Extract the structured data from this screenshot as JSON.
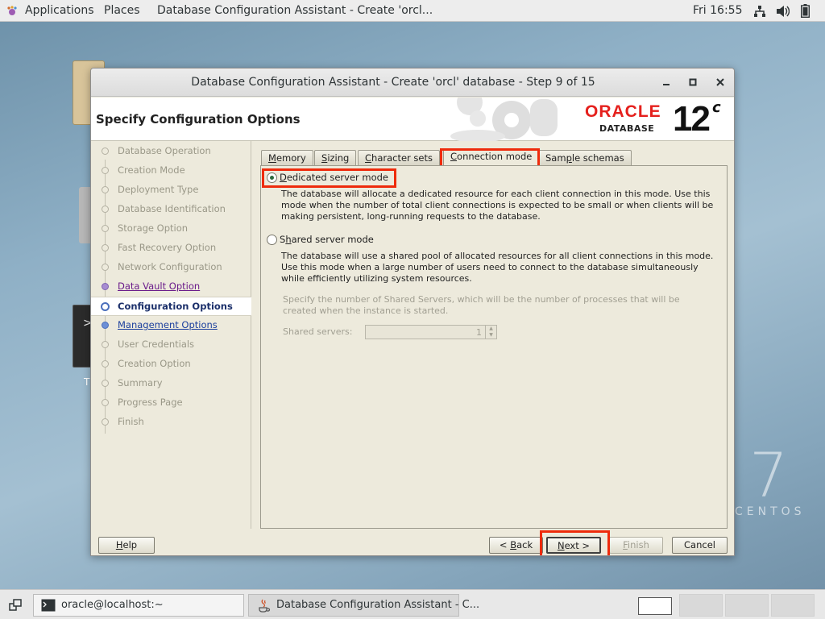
{
  "topbar": {
    "applications": "Applications",
    "places": "Places",
    "window_title": "Database Configuration Assistant - Create 'orcl...",
    "clock": "Fri 16:55"
  },
  "desktop": {
    "terminal_label": "T",
    "centos_seven": "7",
    "centos_word": "CENTOS"
  },
  "window": {
    "title": "Database Configuration Assistant - Create 'orcl' database - Step 9 of 15",
    "page_title": "Specify Configuration Options",
    "oracle": {
      "brand": "ORACLE",
      "product": "DATABASE",
      "version": "12",
      "version_suffix": "c"
    }
  },
  "steps": [
    {
      "label": "Database Operation",
      "state": "done"
    },
    {
      "label": "Creation Mode",
      "state": "done"
    },
    {
      "label": "Deployment Type",
      "state": "done"
    },
    {
      "label": "Database Identification",
      "state": "done"
    },
    {
      "label": "Storage Option",
      "state": "done"
    },
    {
      "label": "Fast Recovery Option",
      "state": "done"
    },
    {
      "label": "Network Configuration",
      "state": "done"
    },
    {
      "label": "Data Vault Option",
      "state": "visited"
    },
    {
      "label": "Configuration Options",
      "state": "current"
    },
    {
      "label": "Management Options",
      "state": "link"
    },
    {
      "label": "User Credentials",
      "state": "todo"
    },
    {
      "label": "Creation Option",
      "state": "todo"
    },
    {
      "label": "Summary",
      "state": "todo"
    },
    {
      "label": "Progress Page",
      "state": "todo"
    },
    {
      "label": "Finish",
      "state": "todo"
    }
  ],
  "tabs": {
    "memory": {
      "mnemonic": "M",
      "rest": "emory"
    },
    "sizing": {
      "mnemonic": "S",
      "rest": "izing"
    },
    "charsets": {
      "mnemonic": "C",
      "rest": "haracter sets"
    },
    "connection": {
      "mnemonic": "C",
      "rest": "onnection mode"
    },
    "sample": {
      "pre": "Sam",
      "mnemonic": "p",
      "rest": "le schemas"
    }
  },
  "connection_mode": {
    "dedicated": {
      "mnemonic": "D",
      "rest": "edicated server mode",
      "checked": true,
      "description": "The database will allocate a dedicated resource for each client connection in this mode. Use this mode when the number of total client connections is expected to be small or when clients will be making persistent, long-running requests to the database."
    },
    "shared": {
      "pre": "S",
      "mnemonic": "h",
      "rest": "ared server mode",
      "checked": false,
      "description": "The database will use a shared pool of allocated resources for all client connections in this mode.  Use this mode when a large number of users need to connect to the database simultaneously while efficiently utilizing system resources.",
      "servers_hint": "Specify the number of Shared Servers, which will be the number of processes that will be created when the instance is started.",
      "servers_label": "Shared servers:",
      "servers_value": "1"
    }
  },
  "buttons": {
    "help": {
      "mnemonic": "H",
      "rest": "elp"
    },
    "back": {
      "pre": "< ",
      "mnemonic": "B",
      "rest": "ack"
    },
    "next": {
      "mnemonic": "N",
      "rest": "ext >"
    },
    "finish": {
      "mnemonic": "F",
      "rest": "inish"
    },
    "cancel": "Cancel"
  },
  "taskbar": {
    "terminal_task": "oracle@localhost:~",
    "dbca_task": "Database Configuration Assistant - C..."
  },
  "colors": {
    "highlight": "#ee2b0c",
    "oracle_red": "#e5201d",
    "link_blue": "#1b3f9d",
    "visited_purple": "#6a1b8a"
  }
}
